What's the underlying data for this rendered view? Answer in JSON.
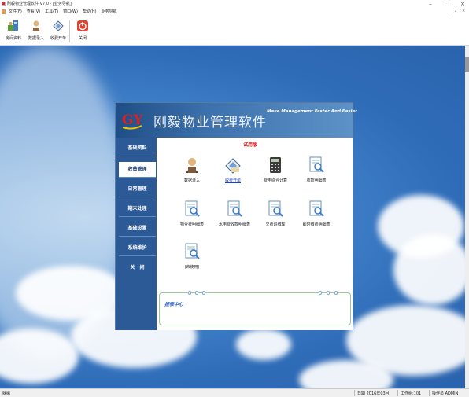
{
  "window": {
    "title": "刚毅物业管理软件 V7.0 - [业务导航]",
    "controls": {
      "minimize": "–",
      "maximize": "□",
      "close": "×"
    }
  },
  "menubar": {
    "items": [
      "文件(F)",
      "查看(V)",
      "工具(T)",
      "窗口(W)",
      "帮助(H)",
      "业务导航"
    ],
    "mdi_controls": {
      "minimize": "_",
      "restore": "ₑ",
      "close": "×"
    }
  },
  "toolbar": {
    "buttons": [
      {
        "label": "房间资料",
        "icon": "room-data-icon"
      },
      {
        "label": "数据录入",
        "icon": "data-entry-icon"
      },
      {
        "label": "收费开单",
        "icon": "billing-icon"
      },
      {
        "label": "关闭",
        "icon": "close-power-icon"
      }
    ]
  },
  "dialog": {
    "logo_text": "GY",
    "title": "刚毅物业管理软件",
    "slogan": "Make Management Faster And Easier",
    "trial_label": "试用版",
    "nav": [
      "基础资料",
      "收费管理",
      "日常管理",
      "期末处理",
      "基础设置",
      "系统维护",
      "关　闭"
    ],
    "active_nav": "收费管理",
    "functions": [
      {
        "label": "数据录入",
        "icon": "data-entry-icon",
        "link": false
      },
      {
        "label": "收费开单",
        "icon": "billing-icon",
        "link": true
      },
      {
        "label": "费用综合计算",
        "icon": "calculator-icon",
        "link": false
      },
      {
        "label": "收款明细表",
        "icon": "report-icon",
        "link": false
      },
      {
        "label": "物业费明细表",
        "icon": "report-icon",
        "link": false
      },
      {
        "label": "水电费收款明细表",
        "icon": "report-icon",
        "link": false
      },
      {
        "label": "欠费追缴理",
        "icon": "report-icon",
        "link": false
      },
      {
        "label": "即时缴费明细表",
        "icon": "report-icon",
        "link": false
      },
      {
        "label": "(未使用)",
        "icon": "report-icon",
        "link": false
      }
    ],
    "report_center": "报表中心"
  },
  "statusbar": {
    "left": "就绪",
    "date": "日期 2016年03月",
    "operator_id": "工作组:101",
    "operator": "操作员 ADMIN"
  },
  "colors": {
    "header_blue": "#2b5a96",
    "trial_red": "#e01818",
    "link_blue": "#1a3fd8"
  }
}
